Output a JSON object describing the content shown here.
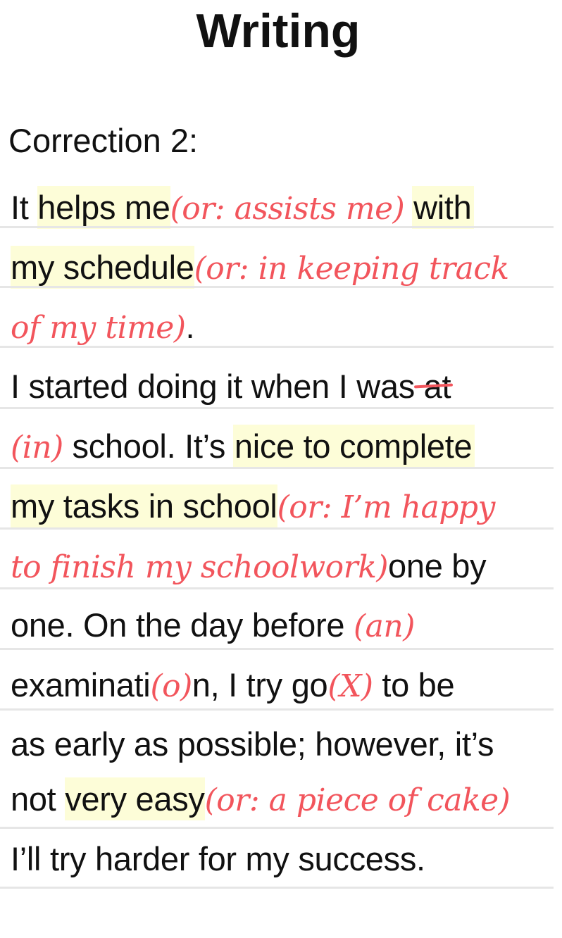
{
  "title": "Writing",
  "subtitle": "Correction 2:",
  "colors": {
    "correction": "#f2555c",
    "highlight": "#fdfdd8",
    "rule": "#e6e6e6",
    "text": "#111111"
  },
  "lines": [
    {
      "seg1": "It ",
      "hl1": "helps me",
      "corr1": "(or: assists me)",
      "seg2": " ",
      "hl2": "with"
    },
    {
      "hl1": "my schedule",
      "corr1": "(or: in keeping track"
    },
    {
      "corr1": "of my time)",
      "seg1": "."
    },
    {
      "seg1": "I started doing it when I was",
      "strike": "at"
    },
    {
      "corr1": "(in)",
      "seg1": " school. It’s ",
      "hl1": "nice to complete"
    },
    {
      "hl1": "my tasks in school",
      "corr1": "(or: I’m happy"
    },
    {
      "corr1": "to finish my schoolwork)",
      "seg1": "one by"
    },
    {
      "seg1": "one. On the day before ",
      "corr1": "(an)"
    },
    {
      "seg1": "examinati",
      "corr1": "(o)",
      "seg2": "n, I try go",
      "corr2": "(X)",
      "seg3": " to be"
    },
    {
      "seg1": "as early as possible; however, it’s"
    },
    {
      "seg1": "not ",
      "hl1": "very easy",
      "corr1": "(or: a piece of cake)"
    },
    {
      "seg1": "I’ll try harder for my success."
    }
  ]
}
